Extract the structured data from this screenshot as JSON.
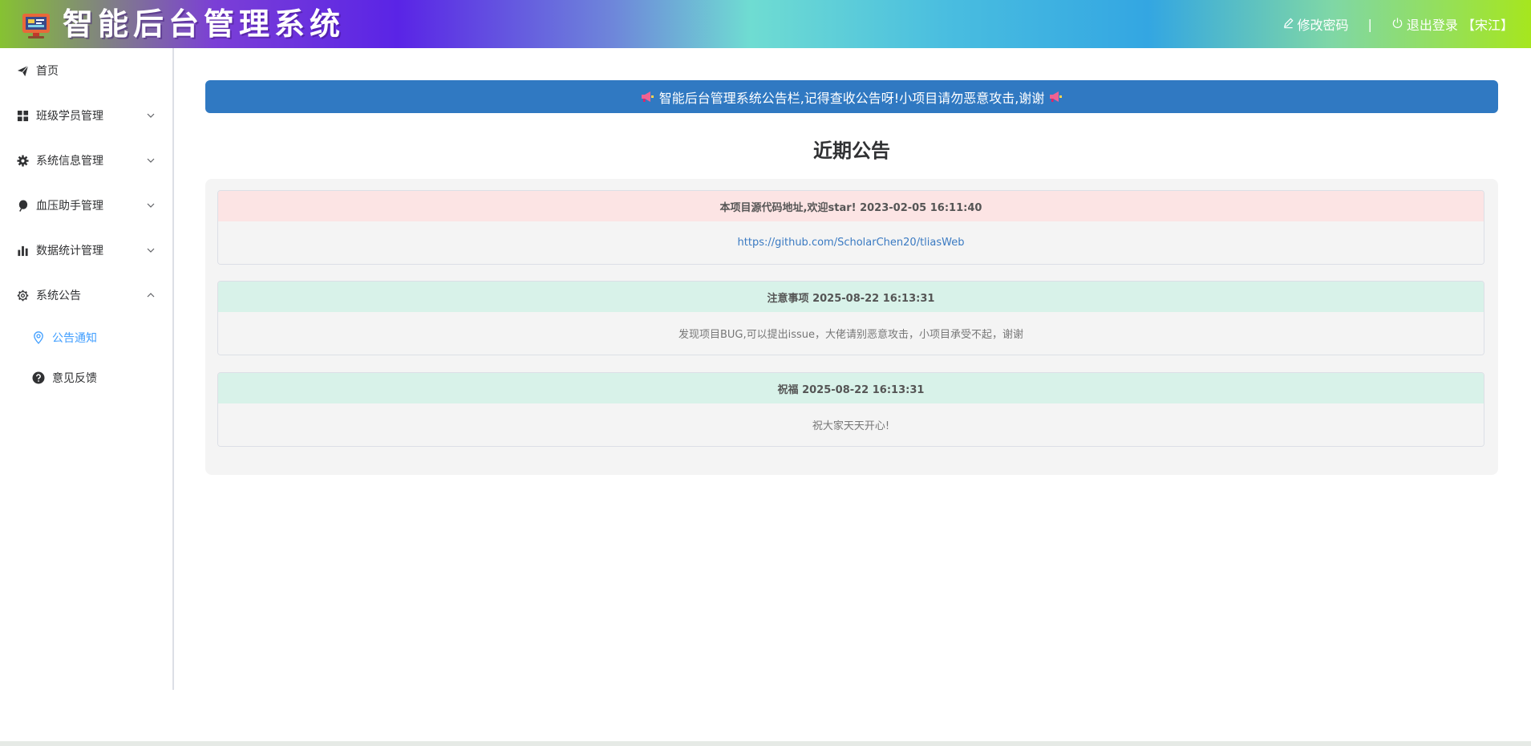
{
  "header": {
    "title": "智能后台管理系统",
    "change_password": "修改密码",
    "separator": "|",
    "logout": "退出登录 【宋江】"
  },
  "sidebar": {
    "items": [
      {
        "label": "首页",
        "icon": "paper-plane-icon"
      },
      {
        "label": "班级学员管理",
        "icon": "grid-icon",
        "expanded": false
      },
      {
        "label": "系统信息管理",
        "icon": "gear-icon",
        "expanded": false
      },
      {
        "label": "血压助手管理",
        "icon": "balloon-icon",
        "expanded": false
      },
      {
        "label": "数据统计管理",
        "icon": "bar-chart-icon",
        "expanded": false
      },
      {
        "label": "系统公告",
        "icon": "settings-outline-icon",
        "expanded": true
      }
    ],
    "subitems": [
      {
        "label": "公告通知",
        "icon": "location-icon",
        "active": true
      },
      {
        "label": "意见反馈",
        "icon": "question-circle-icon",
        "active": false
      }
    ]
  },
  "main": {
    "banner": "智能后台管理系统公告栏,记得查收公告呀!小项目请勿恶意攻击,谢谢",
    "section_title": "近期公告",
    "notices": [
      {
        "title": "本项目源代码地址,欢迎star! 2023-02-05 16:11:40",
        "content": "https://github.com/ScholarChen20/tliasWeb",
        "is_link": true
      },
      {
        "title": "注意事项 2025-08-22 16:13:31",
        "content": "发现项目BUG,可以提出issue，大佬请别恶意攻击，小项目承受不起，谢谢",
        "is_link": false
      },
      {
        "title": "祝福 2025-08-22 16:13:31",
        "content": "祝大家天天开心!",
        "is_link": false
      }
    ]
  },
  "colors": {
    "banner": "#3079c2",
    "active_menu": "#409eff",
    "notice_pink": "#fce4e4",
    "notice_mint": "#d8f2e9",
    "link": "#3a7ac2"
  }
}
